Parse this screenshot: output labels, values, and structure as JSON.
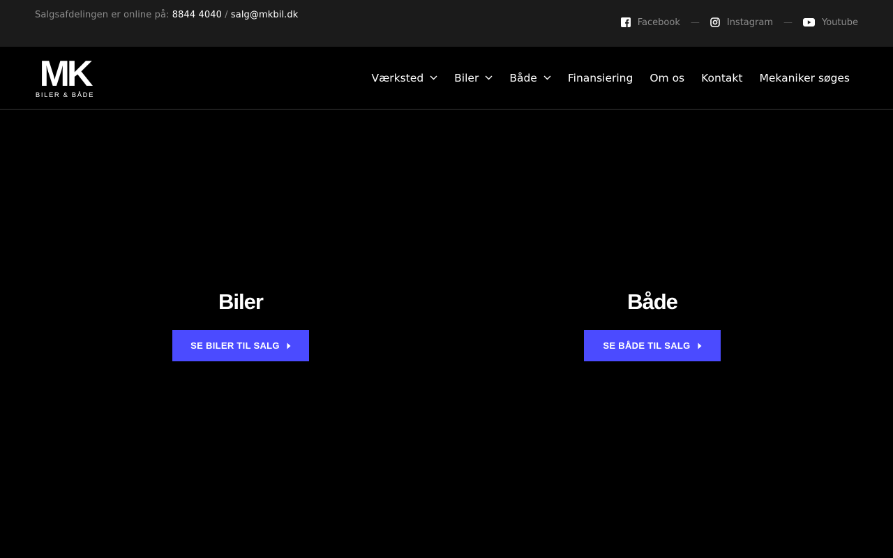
{
  "topbar": {
    "contact_prefix": "Salgsafdelingen er online på: ",
    "phone": "8844 4040",
    "separator": " / ",
    "email": "salg@mkbil.dk",
    "social": [
      {
        "label": "Facebook",
        "icon": "facebook-icon"
      },
      {
        "label": "Instagram",
        "icon": "instagram-icon"
      },
      {
        "label": "Youtube",
        "icon": "youtube-icon"
      }
    ],
    "social_separator": "—"
  },
  "logo": {
    "main": "MK",
    "sub": "BILER & BÅDE"
  },
  "nav": {
    "items": [
      {
        "label": "Værksted",
        "has_dropdown": true
      },
      {
        "label": "Biler",
        "has_dropdown": true
      },
      {
        "label": "Både",
        "has_dropdown": true
      },
      {
        "label": "Finansiering",
        "has_dropdown": false
      },
      {
        "label": "Om os",
        "has_dropdown": false
      },
      {
        "label": "Kontakt",
        "has_dropdown": false
      },
      {
        "label": "Mekaniker søges",
        "has_dropdown": false
      }
    ]
  },
  "hero": {
    "panels": [
      {
        "title": "Biler",
        "button": "SE BILER TIL SALG"
      },
      {
        "title": "Både",
        "button": "SE BÅDE TIL SALG"
      }
    ]
  },
  "colors": {
    "accent": "#4b4bff",
    "topbar_bg": "#1b1b1b",
    "page_bg": "#000000",
    "muted_text": "#8d8d8d"
  }
}
